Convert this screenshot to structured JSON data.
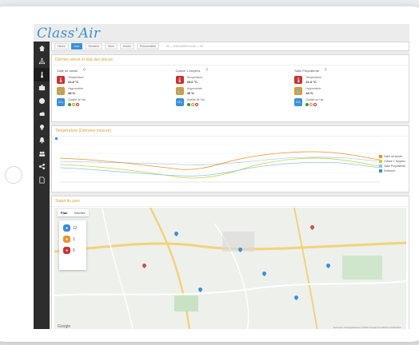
{
  "app": {
    "brand": "Class'Air"
  },
  "sidebar": {
    "items": [
      {
        "icon": "home-icon"
      },
      {
        "icon": "sitemap-icon"
      },
      {
        "icon": "thermometer-icon",
        "active": true
      },
      {
        "icon": "briefcase-icon"
      },
      {
        "icon": "gauge-icon"
      },
      {
        "icon": "cloud-icon"
      },
      {
        "icon": "lightbulb-icon"
      },
      {
        "icon": "bell-icon"
      },
      {
        "icon": "users-icon"
      },
      {
        "icon": "share-icon"
      },
      {
        "icon": "document-icon"
      }
    ]
  },
  "toolbar": {
    "tabs": [
      "Heure",
      "Jour",
      "Semaine",
      "Mois",
      "Année",
      "Personnalisé"
    ],
    "active_index": 1,
    "range_text": "01 — 01/01/2019 14:00 — 02"
  },
  "status_panel": {
    "title": "Dernier relevé et état des pièces",
    "rooms": [
      {
        "name": "Salle de sieste",
        "temperature_label": "Température",
        "temperature_value": "22.8 °C",
        "humidity_label": "Hygrométrie",
        "humidity_value": "48 %",
        "air_quality_label": "Qualité de l'air"
      },
      {
        "name": "Classe 1 Moyens",
        "temperature_label": "Température",
        "temperature_value": "20.6 °C",
        "humidity_label": "Hygrométrie",
        "humidity_value": "46 %",
        "air_quality_label": "Qualité de l'air"
      },
      {
        "name": "Salle Polyvalente",
        "temperature_label": "Température",
        "temperature_value": "21.3 °C",
        "humidity_label": "Hygrométrie",
        "humidity_value": "44 %",
        "air_quality_label": "Qualité de l'air"
      }
    ]
  },
  "chart_panel": {
    "title": "Température (Dernière mesure)",
    "legend": [
      {
        "name": "Salle de sieste",
        "color": "#e9922c"
      },
      {
        "name": "Classe 1 Moyens",
        "color": "#c9cf3a"
      },
      {
        "name": "Salle Polyvalente",
        "color": "#87c7e8"
      },
      {
        "name": "Extérieur",
        "color": "#3b8fd4"
      }
    ],
    "colors": {
      "orange": "#e9922c",
      "yellow": "#c9cf3a",
      "lightblue": "#87c7e8",
      "blue": "#3b8fd4"
    }
  },
  "map_panel": {
    "title": "Statut du parc",
    "tabs": [
      "Plan",
      "Satellite"
    ],
    "counters": [
      {
        "icon": "info-icon",
        "color": "#3b8fd4",
        "value": "12"
      },
      {
        "icon": "warning-icon",
        "color": "#e7952a",
        "value": "1"
      },
      {
        "icon": "alert-icon",
        "color": "#c73232",
        "value": "6"
      }
    ],
    "google_label": "Google",
    "attribution": "Données cartographiques ©2019 Google  Conditions d'utilisation"
  }
}
